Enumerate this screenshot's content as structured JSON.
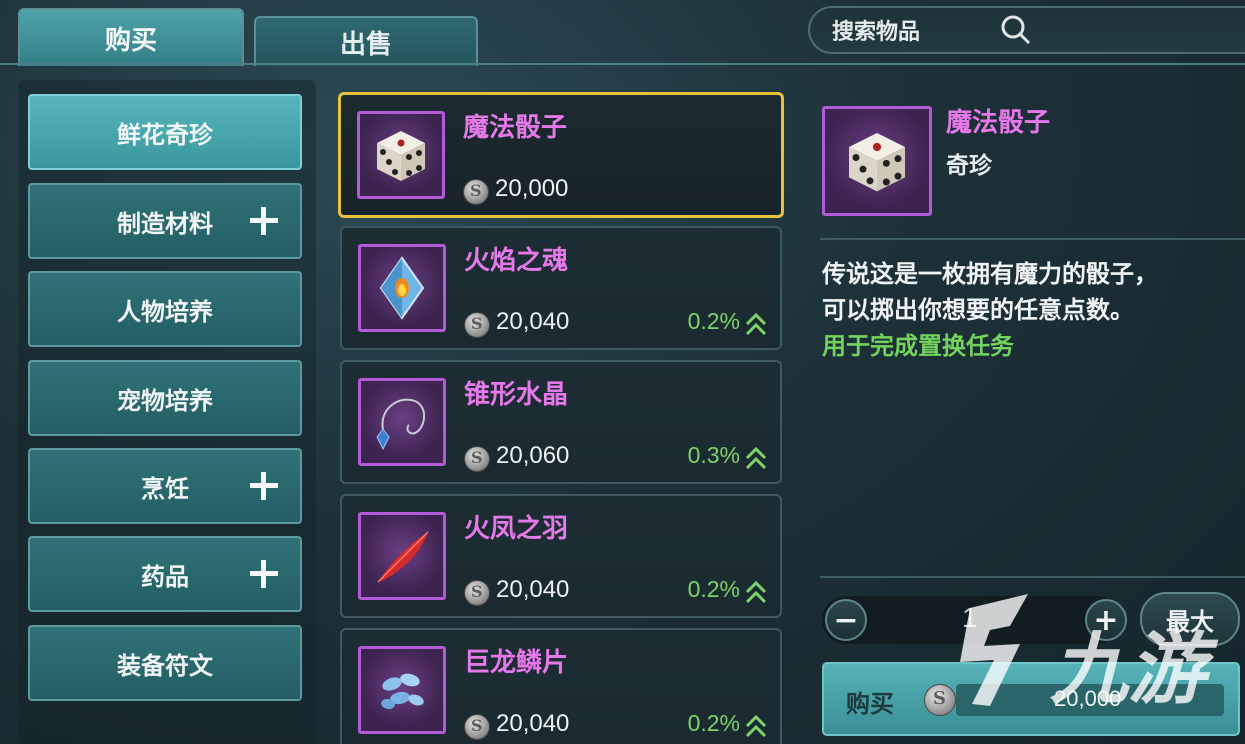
{
  "tabs": {
    "buy": "购买",
    "sell": "出售"
  },
  "search": {
    "placeholder": "搜索物品"
  },
  "categories": [
    {
      "label": "鲜花奇珍",
      "active": true,
      "expandable": false
    },
    {
      "label": "制造材料",
      "active": false,
      "expandable": true
    },
    {
      "label": "人物培养",
      "active": false,
      "expandable": false
    },
    {
      "label": "宠物培养",
      "active": false,
      "expandable": false
    },
    {
      "label": "烹饪",
      "active": false,
      "expandable": true
    },
    {
      "label": "药品",
      "active": false,
      "expandable": true
    },
    {
      "label": "装备符文",
      "active": false,
      "expandable": false
    }
  ],
  "items": [
    {
      "name": "魔法骰子",
      "price": "20,000",
      "change": "",
      "icon": "dice-icon",
      "selected": true
    },
    {
      "name": "火焰之魂",
      "price": "20,040",
      "change": "0.2%",
      "icon": "flame-crystal-icon",
      "selected": false
    },
    {
      "name": "锥形水晶",
      "price": "20,060",
      "change": "0.3%",
      "icon": "pendulum-crystal-icon",
      "selected": false
    },
    {
      "name": "火凤之羽",
      "price": "20,040",
      "change": "0.2%",
      "icon": "red-feather-icon",
      "selected": false
    },
    {
      "name": "巨龙鳞片",
      "price": "20,040",
      "change": "0.2%",
      "icon": "dragon-scales-icon",
      "selected": false
    }
  ],
  "detail": {
    "name": "魔法骰子",
    "type": "奇珍",
    "description": "传说这是一枚拥有魔力的骰子，\n可以掷出你想要的任意点数。",
    "usage": "用于完成置换任务",
    "quantity": "1",
    "max_label": "最大",
    "buy_label": "购买",
    "total_price": "20,000"
  },
  "watermark": {
    "text": "九游"
  },
  "colors": {
    "item_name": "#e679ea",
    "price_up": "#7fd16a",
    "usage": "#74d35d",
    "selected_border": "#e8c23a"
  }
}
